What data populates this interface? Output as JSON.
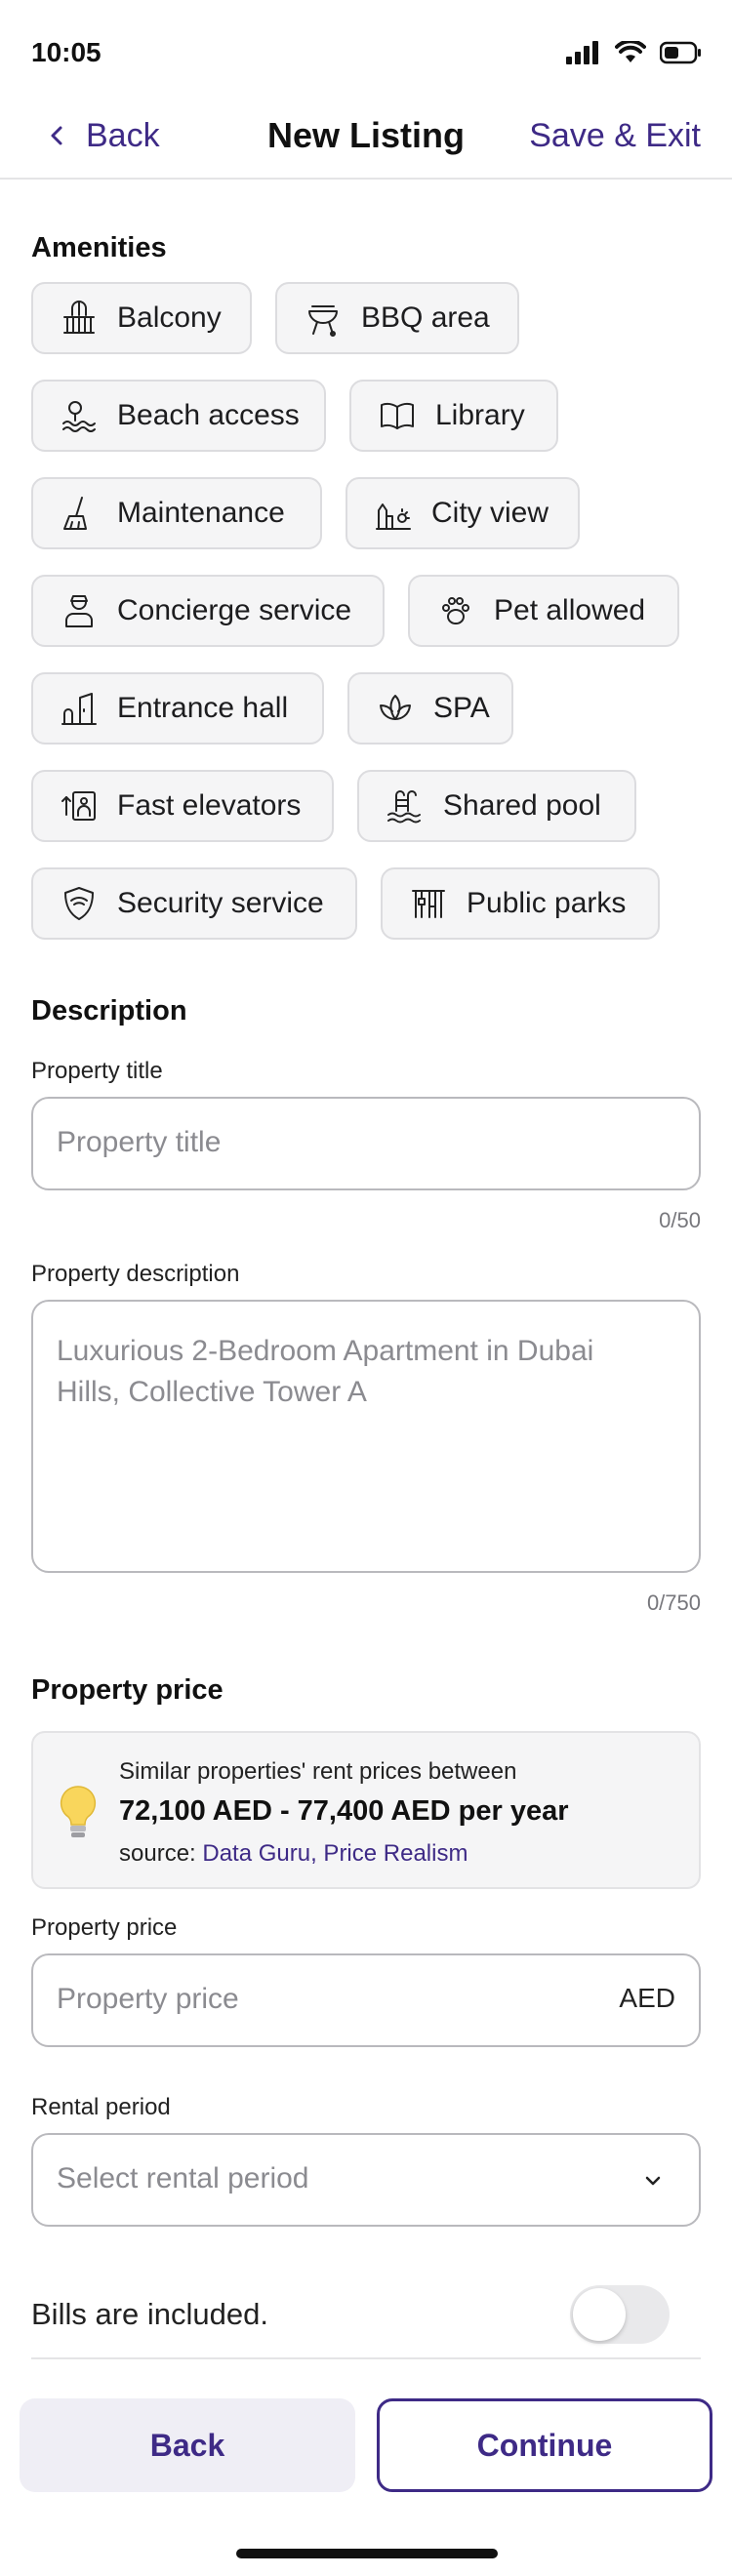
{
  "status_bar": {
    "time": "10:05",
    "icons": [
      "signal-icon",
      "wifi-icon",
      "battery-icon"
    ]
  },
  "header": {
    "back_label": "Back",
    "title": "New Listing",
    "save_label": "Save & Exit"
  },
  "amenities": {
    "title": "Amenities",
    "items": [
      {
        "label": "Balcony",
        "icon": "balcony-icon"
      },
      {
        "label": "BBQ area",
        "icon": "bbq-grill-icon"
      },
      {
        "label": "Beach access",
        "icon": "beach-icon"
      },
      {
        "label": "Library",
        "icon": "book-icon"
      },
      {
        "label": "Maintenance",
        "icon": "broom-icon"
      },
      {
        "label": "City view",
        "icon": "city-sun-icon"
      },
      {
        "label": "Concierge service",
        "icon": "concierge-icon"
      },
      {
        "label": "Pet allowed",
        "icon": "paw-icon"
      },
      {
        "label": "Entrance hall",
        "icon": "entrance-icon"
      },
      {
        "label": "SPA",
        "icon": "lotus-icon"
      },
      {
        "label": "Fast elevators",
        "icon": "elevator-icon"
      },
      {
        "label": "Shared pool",
        "icon": "pool-icon"
      },
      {
        "label": "Security service",
        "icon": "shield-icon"
      },
      {
        "label": "Public parks",
        "icon": "park-icon"
      }
    ]
  },
  "description": {
    "title": "Description",
    "property_title": {
      "label": "Property title",
      "placeholder": "Property title",
      "counter": "0/50"
    },
    "property_description": {
      "label": "Property description",
      "placeholder": "Luxurious 2-Bedroom Apartment in Dubai Hills, Collective Tower A",
      "counter": "0/750"
    }
  },
  "price": {
    "title": "Property price",
    "hint": {
      "line1": "Similar properties' rent prices between",
      "range": "72,100 AED - 77,400 AED per year",
      "source_prefix": "source: ",
      "source_link": "Data Guru, Price Realism"
    },
    "field": {
      "label": "Property price",
      "placeholder": "Property price",
      "suffix": "AED"
    },
    "rental_period": {
      "label": "Rental period",
      "placeholder": "Select rental period"
    },
    "bills_label": "Bills are included.",
    "bills_included": false
  },
  "footer": {
    "back_label": "Back",
    "continue_label": "Continue"
  },
  "colors": {
    "accent": "#3e2a86",
    "chip_background": "#f5f5f6",
    "back_button_background": "#efeef5"
  }
}
